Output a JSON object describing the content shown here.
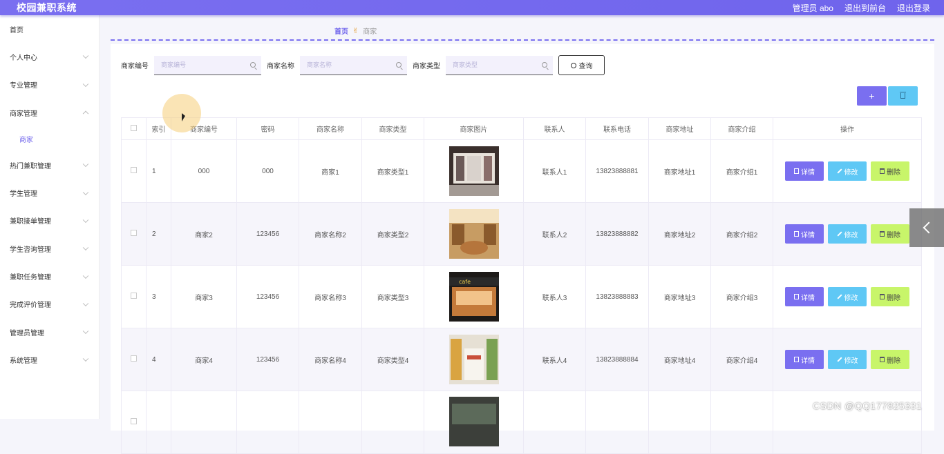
{
  "app": {
    "title": "校园兼职系统"
  },
  "topbar": {
    "user": "管理员 abo",
    "front": "退出到前台",
    "logout": "退出登录"
  },
  "sidebar": {
    "items": [
      {
        "label": "首页"
      },
      {
        "label": "个人中心"
      },
      {
        "label": "专业管理"
      },
      {
        "label": "商家管理"
      },
      {
        "label": "热门兼职管理"
      },
      {
        "label": "学生管理"
      },
      {
        "label": "兼职接单管理"
      },
      {
        "label": "学生咨询管理"
      },
      {
        "label": "兼职任务管理"
      },
      {
        "label": "完成评价管理"
      },
      {
        "label": "管理员管理"
      },
      {
        "label": "系统管理"
      }
    ],
    "submenu": {
      "label": "商家"
    }
  },
  "breadcrumb": {
    "home": "首页",
    "current": "商家"
  },
  "search": {
    "f1_label": "商家编号",
    "f1_placeholder": "商家编号",
    "f2_label": "商家名称",
    "f2_placeholder": "商家名称",
    "f3_label": "商家类型",
    "f3_placeholder": "商家类型",
    "query_label": "查询"
  },
  "toolbar": {
    "add_label": "+"
  },
  "table": {
    "headers": [
      "索引",
      "商家编号",
      "密码",
      "商家名称",
      "商家类型",
      "商家图片",
      "联系人",
      "联系电话",
      "商家地址",
      "商家介绍",
      "操作"
    ],
    "rows": [
      {
        "index": "1",
        "code": "000",
        "password": "000",
        "name": "商家1",
        "type": "商家类型1",
        "contact": "联系人1",
        "phone": "13823888881",
        "address": "商家地址1",
        "intro": "商家介绍1"
      },
      {
        "index": "2",
        "code": "商家2",
        "password": "123456",
        "name": "商家名称2",
        "type": "商家类型2",
        "contact": "联系人2",
        "phone": "13823888882",
        "address": "商家地址2",
        "intro": "商家介绍2"
      },
      {
        "index": "3",
        "code": "商家3",
        "password": "123456",
        "name": "商家名称3",
        "type": "商家类型3",
        "contact": "联系人3",
        "phone": "13823888883",
        "address": "商家地址3",
        "intro": "商家介绍3"
      },
      {
        "index": "4",
        "code": "商家4",
        "password": "123456",
        "name": "商家名称4",
        "type": "商家类型4",
        "contact": "联系人4",
        "phone": "13823888884",
        "address": "商家地址4",
        "intro": "商家介绍4"
      }
    ],
    "actions": {
      "view": "详情",
      "edit": "修改",
      "delete": "删除"
    }
  },
  "watermark": "CSDN @QQ177825331",
  "colors": {
    "accent": "#7a6ff0",
    "edit": "#5fc8f5",
    "delete": "#c8f56a"
  }
}
